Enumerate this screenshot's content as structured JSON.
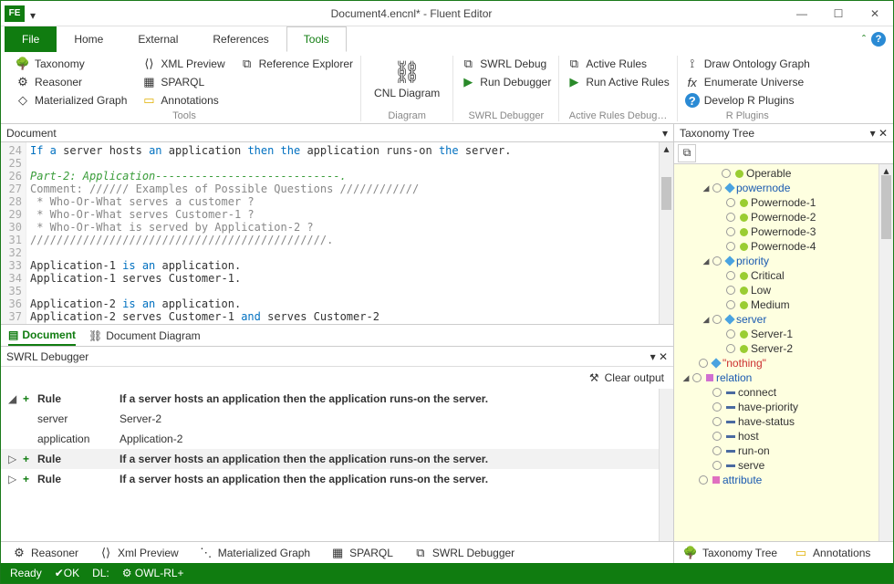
{
  "window": {
    "title": "Document4.encnl* - Fluent Editor"
  },
  "menu": {
    "file": "File",
    "home": "Home",
    "external": "External",
    "references": "References",
    "tools": "Tools"
  },
  "ribbon": {
    "tools": {
      "taxonomy": "Taxonomy",
      "xmlpreview": "XML Preview",
      "refexplorer": "Reference Explorer",
      "reasoner": "Reasoner",
      "sparql": "SPARQL",
      "matgraph": "Materialized Graph",
      "annotations": "Annotations",
      "label": "Tools"
    },
    "diagram": {
      "cnl": "CNL Diagram",
      "label": "Diagram"
    },
    "swrl": {
      "debug": "SWRL Debug",
      "run": "Run Debugger",
      "label": "SWRL Debugger"
    },
    "active": {
      "rules": "Active Rules",
      "run": "Run Active Rules",
      "label": "Active Rules Debug…"
    },
    "rplugins": {
      "draw": "Draw Ontology Graph",
      "enum": "Enumerate Universe",
      "dev": "Develop R Plugins",
      "label": "R Plugins"
    }
  },
  "document": {
    "header": "Document",
    "lines": [
      "24",
      "25",
      "26",
      "27",
      "28",
      "29",
      "30",
      "31",
      "32",
      "33",
      "34",
      "35",
      "36",
      "37"
    ],
    "l24_a": "If a",
    "l24_b": " server hosts ",
    "l24_c": "an",
    "l24_d": " application ",
    "l24_e": "then the",
    "l24_f": " application runs-on ",
    "l24_g": "the",
    "l24_h": " server.",
    "l26": "Part-2: Application----------------------------.",
    "l27": "Comment: ////// Examples of Possible Questions ////////////",
    "l28": " * Who-Or-What serves a customer ?",
    "l29": " * Who-Or-What serves Customer-1 ?",
    "l30": " * Who-Or-What is served by Application-2 ?",
    "l31": "/////////////////////////////////////////////.",
    "l33a": "Application-1 ",
    "l33b": "is an",
    "l33c": " application.",
    "l34": "Application-1 serves Customer-1.",
    "l36a": "Application-2 ",
    "l36b": "is an",
    "l36c": " application.",
    "l37a": "Application-2 serves Customer-1 ",
    "l37b": "and",
    "l37c": " serves Customer-2",
    "tabs": {
      "document": "Document",
      "diagram": "Document Diagram"
    }
  },
  "swrl": {
    "title": "SWRL Debugger",
    "clear": "Clear output",
    "rule_label": "Rule",
    "rule_text": "If a server hosts an application then the application runs-on the server.",
    "k_server": "server",
    "v_server": "Server-2",
    "k_app": "application",
    "v_app": "Application-2"
  },
  "bottom": {
    "reasoner": "Reasoner",
    "xml": "Xml Preview",
    "mat": "Materialized Graph",
    "sparql": "SPARQL",
    "swrl": "SWRL Debugger"
  },
  "taxonomy": {
    "title": "Taxonomy Tree",
    "items": {
      "operable": "Operable",
      "powernode": "powernode",
      "p1": "Powernode-1",
      "p2": "Powernode-2",
      "p3": "Powernode-3",
      "p4": "Powernode-4",
      "priority": "priority",
      "critical": "Critical",
      "low": "Low",
      "medium": "Medium",
      "server": "server",
      "s1": "Server-1",
      "s2": "Server-2",
      "nothing": "\"nothing\"",
      "relation": "relation",
      "connect": "connect",
      "havep": "have-priority",
      "haves": "have-status",
      "host": "host",
      "runon": "run-on",
      "serve": "serve",
      "attribute": "attribute"
    },
    "tabs": {
      "tree": "Taxonomy Tree",
      "ann": "Annotations"
    }
  },
  "status": {
    "ready": "Ready",
    "ok": "OK",
    "dl": "DL:",
    "owl": "OWL-RL+"
  }
}
